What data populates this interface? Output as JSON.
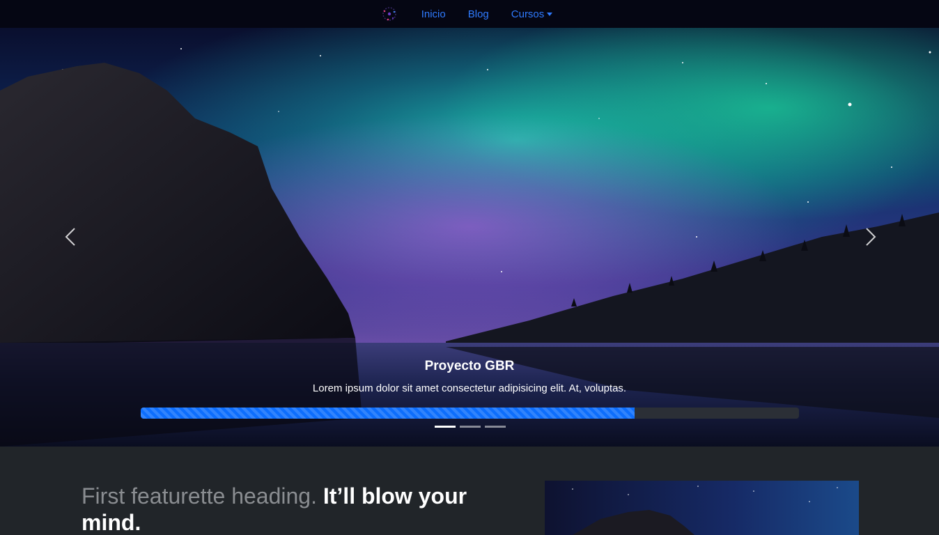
{
  "navbar": {
    "logo_icon": "atom-logo-icon",
    "links": [
      {
        "label": "Inicio"
      },
      {
        "label": "Blog"
      },
      {
        "label": "Cursos",
        "dropdown": true
      }
    ],
    "link_color": "#2f7bff"
  },
  "carousel": {
    "caption_title": "Proyecto GBR",
    "caption_text": "Lorem ipsum dolor sit amet consectetur adipisicing elit. At, voluptas.",
    "progress_fraction": 0.75,
    "indicators": 3,
    "active_indicator": 0,
    "prev_icon": "chevron-left-icon",
    "next_icon": "chevron-right-icon",
    "progress_color": "#0d6efd"
  },
  "featurette": {
    "heading_muted": "First featurette heading.",
    "heading_strong": "It’ll blow your mind."
  }
}
